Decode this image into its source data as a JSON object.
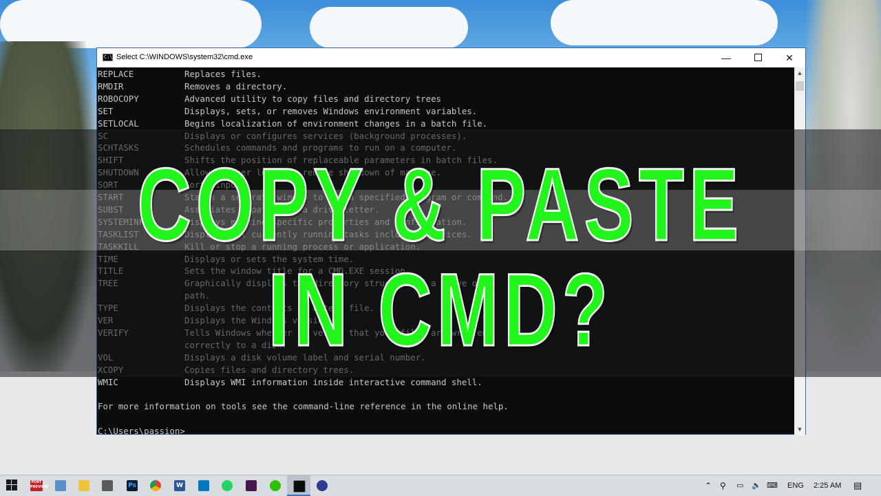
{
  "window": {
    "title": "Select C:\\WINDOWS\\system32\\cmd.exe",
    "icon": "cmd-icon",
    "icon_text": "C:\\",
    "minimize": "—",
    "close": "✕"
  },
  "console": {
    "rows": [
      {
        "cmd": "REPLACE",
        "desc": "Replaces files."
      },
      {
        "cmd": "RMDIR",
        "desc": "Removes a directory."
      },
      {
        "cmd": "ROBOCOPY",
        "desc": "Advanced utility to copy files and directory trees"
      },
      {
        "cmd": "SET",
        "desc": "Displays, sets, or removes Windows environment variables."
      },
      {
        "cmd": "SETLOCAL",
        "desc": "Begins localization of environment changes in a batch file."
      },
      {
        "cmd": "SC",
        "desc": "Displays or configures services (background processes)."
      },
      {
        "cmd": "SCHTASKS",
        "desc": "Schedules commands and programs to run on a computer."
      },
      {
        "cmd": "SHIFT",
        "desc": "Shifts the position of replaceable parameters in batch files."
      },
      {
        "cmd": "SHUTDOWN",
        "desc": "Allows proper local or remote shutdown of machine."
      },
      {
        "cmd": "SORT",
        "desc": "Sorts input."
      },
      {
        "cmd": "START",
        "desc": "Starts a separate window to run a specified program or command."
      },
      {
        "cmd": "SUBST",
        "desc": "Associates a path with a drive letter."
      },
      {
        "cmd": "SYSTEMINFO",
        "desc": "Displays machine specific properties and configuration."
      },
      {
        "cmd": "TASKLIST",
        "desc": "Displays all currently running tasks including services."
      },
      {
        "cmd": "TASKKILL",
        "desc": "Kill or stop a running process or application."
      },
      {
        "cmd": "TIME",
        "desc": "Displays or sets the system time."
      },
      {
        "cmd": "TITLE",
        "desc": "Sets the window title for a CMD.EXE session."
      },
      {
        "cmd": "TREE",
        "desc": "Graphically displays the directory structure of a drive or"
      },
      {
        "cmd": "",
        "desc": "path."
      },
      {
        "cmd": "TYPE",
        "desc": "Displays the contents of a text file."
      },
      {
        "cmd": "VER",
        "desc": "Displays the Windows version."
      },
      {
        "cmd": "VERIFY",
        "desc": "Tells Windows whether to verify that your files are written"
      },
      {
        "cmd": "",
        "desc": "correctly to a disk."
      },
      {
        "cmd": "VOL",
        "desc": "Displays a disk volume label and serial number."
      },
      {
        "cmd": "XCOPY",
        "desc": "Copies files and directory trees."
      },
      {
        "cmd": "WMIC",
        "desc": "Displays WMI information inside interactive command shell."
      }
    ],
    "footer": "For more information on tools see the command-line reference in the online help.",
    "prompt": "C:\\Users\\passion>"
  },
  "overlay": {
    "line1": "COPY & PASTE",
    "line2": "IN CMD?",
    "color": "#22f51b"
  },
  "taskbar": {
    "icons": [
      "windows-start-icon",
      "photo-studio-icon",
      "notepad-icon",
      "file-explorer-icon",
      "calculator-icon",
      "photoshop-icon",
      "chrome-icon",
      "word-icon",
      "trello-icon",
      "whatsapp-icon",
      "slack-icon",
      "wechat-icon",
      "cmd-taskbar-icon",
      "app-icon"
    ],
    "start_badge": "PORT\nPREVIEW",
    "ps_label": "Ps",
    "word_label": "W",
    "language": "ENG",
    "time": "2:25 AM"
  }
}
